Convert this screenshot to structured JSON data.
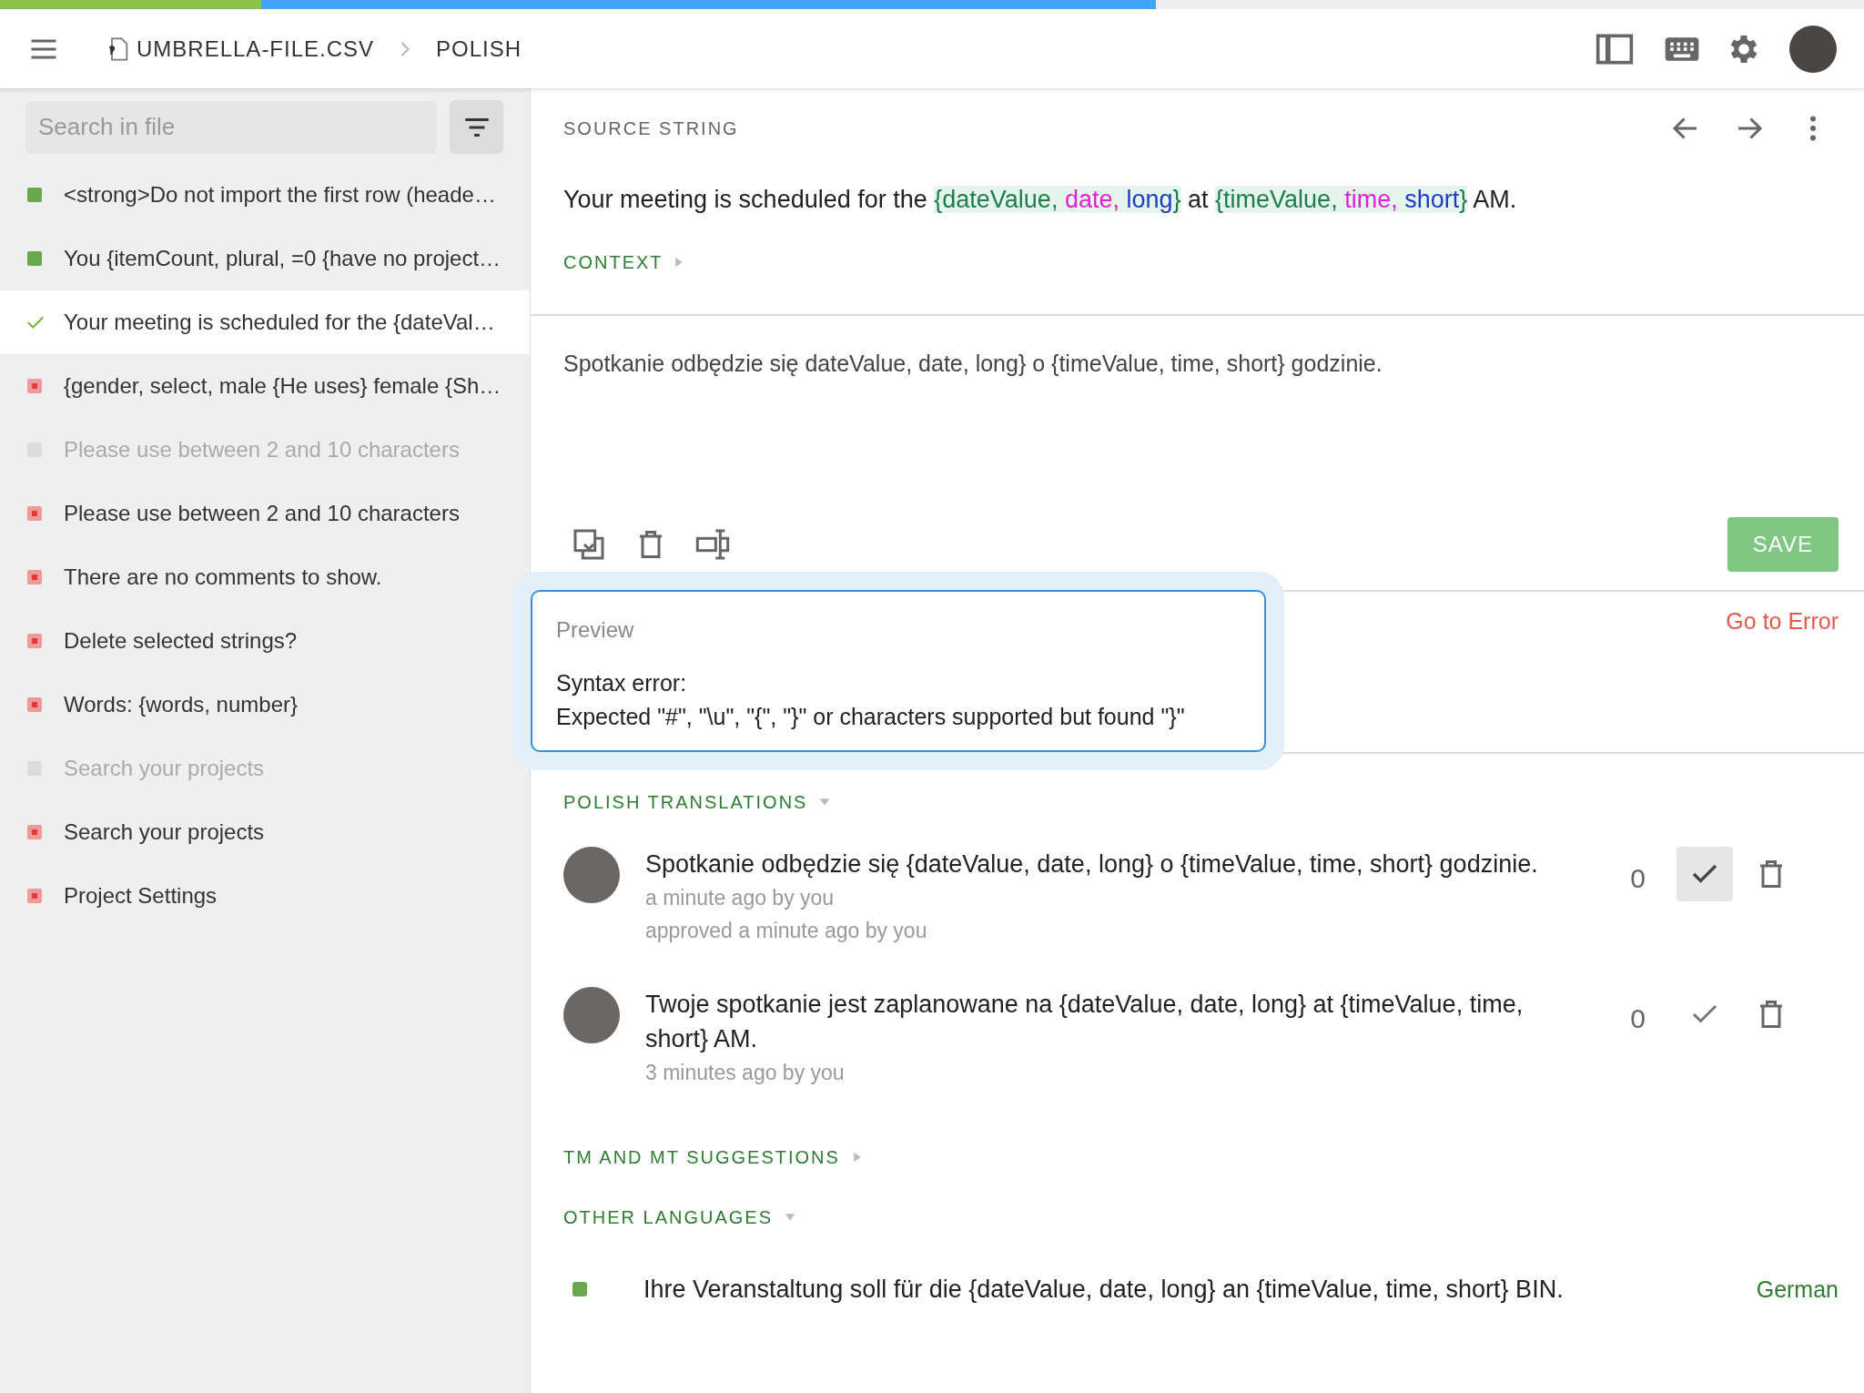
{
  "progress": [
    {
      "kind": "translated",
      "level": 0.62
    },
    {
      "kind": "approved",
      "level": 0.14
    }
  ],
  "breadcrumb": {
    "file": "UMBRELLA-FILE.CSV",
    "language": "POLISH"
  },
  "sidebar": {
    "search": {
      "placeholder": "Search in file"
    },
    "items": [
      {
        "text": "<strong>Do not import the first row (heade…",
        "kind": "translated",
        "selected": false
      },
      {
        "text": "You {itemCount, plural, =0 {have no project…",
        "kind": "translated",
        "selected": false
      },
      {
        "text": "Your meeting is scheduled for the {dateVal…",
        "kind": "approved",
        "selected": true
      },
      {
        "text": "{gender, select, male {He uses} female {Sh…",
        "kind": "untranslated",
        "selected": false
      },
      {
        "text": "Please use between 2 and 10 characters",
        "kind": "empty",
        "selected": false
      },
      {
        "text": "Please use between 2 and 10 characters",
        "kind": "untranslated",
        "selected": false
      },
      {
        "text": "There are no comments to show.",
        "kind": "untranslated",
        "selected": false
      },
      {
        "text": "Delete selected strings?",
        "kind": "untranslated",
        "selected": false
      },
      {
        "text": "Words: {words, number}",
        "kind": "untranslated",
        "selected": false
      },
      {
        "text": "Search your projects",
        "kind": "empty",
        "selected": false
      },
      {
        "text": "Search your projects",
        "kind": "untranslated",
        "selected": false
      },
      {
        "text": "Project Settings",
        "kind": "untranslated",
        "selected": false
      }
    ]
  },
  "source": {
    "label": "SOURCE STRING",
    "segments": [
      {
        "kind": "text",
        "text": "Your meeting is scheduled for the "
      },
      {
        "kind": "name",
        "text": "{dateValue, "
      },
      {
        "kind": "type",
        "text": "date, "
      },
      {
        "kind": "style",
        "text": "long"
      },
      {
        "kind": "name",
        "text": "}"
      },
      {
        "kind": "text",
        "text": " at "
      },
      {
        "kind": "name",
        "text": "{timeValue, "
      },
      {
        "kind": "type",
        "text": "time, "
      },
      {
        "kind": "style",
        "text": "short"
      },
      {
        "kind": "name",
        "text": "}"
      },
      {
        "kind": "text",
        "text": " AM."
      }
    ],
    "context": {
      "label": "CONTEXT",
      "expanded": false
    }
  },
  "editor": {
    "value": "Spotkanie odbędzie się dateValue, date, long} o {timeValue, time, short} godzinie.",
    "save": "SAVE"
  },
  "preview": {
    "label": "Preview",
    "lines": [
      "Syntax error:",
      "Expected \"#\", \"\\u\", \"{\", \"}\" or characters supported but found \"}\""
    ],
    "go_to_error": "Go to Error"
  },
  "translations": {
    "title": "POLISH TRANSLATIONS",
    "expanded": true,
    "items": [
      {
        "text": "Spotkanie odbędzie się {dateValue, date, long} o {timeValue, time, short} godzinie.",
        "meta": [
          "a minute ago by you",
          "approved a minute ago by you"
        ],
        "votes": "0",
        "approved": true
      },
      {
        "text": "Twoje spotkanie jest zaplanowane na {dateValue, date, long} at {timeValue, time, short} AM.",
        "meta": [
          "3 minutes ago by you"
        ],
        "votes": "0",
        "approved": false
      }
    ]
  },
  "suggestions": {
    "title": "TM AND MT SUGGESTIONS",
    "expanded": false
  },
  "other_languages": {
    "title": "OTHER LANGUAGES",
    "expanded": true,
    "items": [
      {
        "text": "Ihre Veranstaltung soll für die {dateValue, date, long} an {timeValue, time, short} BIN.",
        "language": "German",
        "kind": "translated"
      }
    ]
  }
}
